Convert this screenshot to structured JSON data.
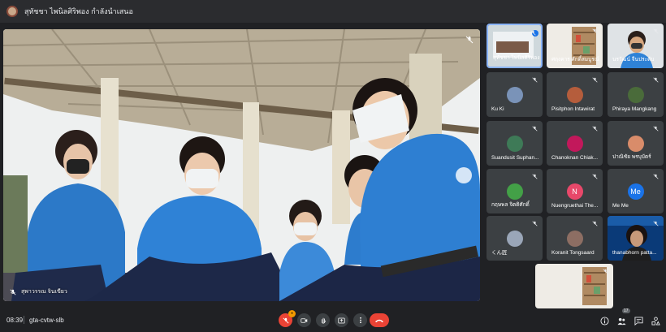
{
  "presenting_bar": {
    "text": "สุทัชชา ไพนิลศิริพอง กำลังนำเสนอ"
  },
  "main_video": {
    "participant_name": "สุพาวรรณ จินเขียว",
    "icon": "mic-off-icon"
  },
  "tiles": [
    {
      "name": "สุทัชชา ไพนิลศิริพอง",
      "type": "photo",
      "variant": "screen",
      "active": true
    },
    {
      "name": "ศฤงคาร ศักดิ์สมบูรณ์",
      "type": "photo",
      "variant": "shelf"
    },
    {
      "name": "นรวัฒน์ จีนประดับ",
      "type": "photo",
      "variant": "person"
    },
    {
      "name": "Ku Ki",
      "type": "avatar",
      "avatar_color": "#7a93b8"
    },
    {
      "name": "Pisitphon Intawirat",
      "type": "avatar",
      "avatar_color": "#b55d3c"
    },
    {
      "name": "Phiraya Mangkang",
      "type": "avatar",
      "avatar_color": "#4a6b3a"
    },
    {
      "name": "Suandusit Suphan...",
      "type": "avatar",
      "avatar_color": "#3e7a57"
    },
    {
      "name": "Chanoknan Chiak...",
      "type": "avatar",
      "avatar_color": "#c2185b"
    },
    {
      "name": "ปาณิชัย พรบุบัตร์",
      "type": "avatar",
      "avatar_color": "#d98c6a"
    },
    {
      "name": "กฤษพล จิตติศักดิ์",
      "type": "avatar",
      "avatar_color": "#43a047"
    },
    {
      "name": "Nuengruethai The...",
      "type": "letter",
      "letter": "N",
      "avatar_color": "#e8486a"
    },
    {
      "name": "Me Me",
      "type": "letter",
      "letter": "Me",
      "avatar_color": "#1a73e8"
    },
    {
      "name": "くん匠",
      "type": "avatar",
      "avatar_color": "#9aa6b8"
    },
    {
      "name": "Koranit Tongsaard",
      "type": "avatar",
      "avatar_color": "#8d6e63"
    },
    {
      "name": "thanabhorn patta...",
      "type": "photo",
      "variant": "woman"
    },
    {
      "name": "",
      "type": "photo",
      "variant": "shelf2"
    }
  ],
  "bottom_bar": {
    "time": "08:39",
    "meeting_code": "gta-cvtw-slb",
    "mic_badge": "•",
    "participant_count": "17"
  },
  "colors": {
    "background": "#202124",
    "tile": "#3c4043",
    "end_call": "#ea4335",
    "active_border": "#8ab4f8"
  }
}
